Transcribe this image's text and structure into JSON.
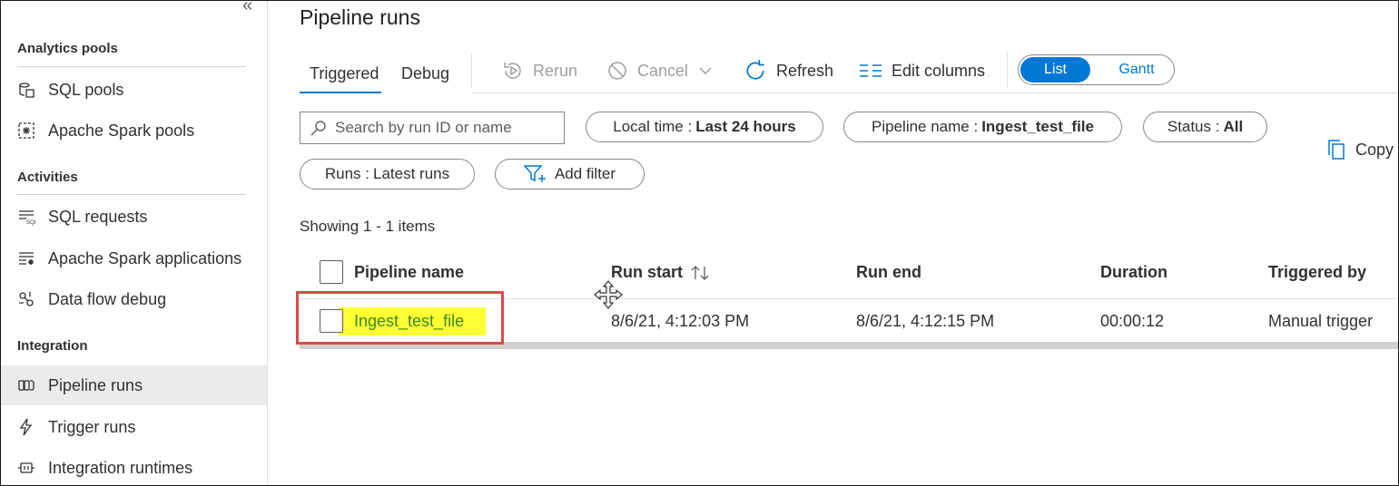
{
  "sidebar": {
    "collapse_glyph": "«",
    "sections": [
      {
        "title": "Analytics pools",
        "items": [
          {
            "label": "SQL pools",
            "icon": "sql-pool-icon"
          },
          {
            "label": "Apache Spark pools",
            "icon": "spark-pool-icon"
          }
        ]
      },
      {
        "title": "Activities",
        "items": [
          {
            "label": "SQL requests",
            "icon": "sql-requests-icon"
          },
          {
            "label": "Apache Spark applications",
            "icon": "spark-applications-icon"
          },
          {
            "label": "Data flow debug",
            "icon": "data-flow-debug-icon"
          }
        ]
      },
      {
        "title": "Integration",
        "items": [
          {
            "label": "Pipeline runs",
            "icon": "pipeline-runs-icon",
            "active": true
          },
          {
            "label": "Trigger runs",
            "icon": "trigger-runs-icon"
          },
          {
            "label": "Integration runtimes",
            "icon": "integration-runtimes-icon"
          }
        ]
      }
    ]
  },
  "main": {
    "title": "Pipeline runs",
    "tabs": [
      {
        "label": "Triggered",
        "selected": true
      },
      {
        "label": "Debug"
      }
    ],
    "toolbar": {
      "rerun": "Rerun",
      "cancel": "Cancel",
      "refresh": "Refresh",
      "edit_columns": "Edit columns",
      "view_toggle": {
        "list": "List",
        "gantt": "Gantt",
        "selected": "List"
      }
    },
    "search_placeholder": "Search by run ID or name",
    "filters": [
      {
        "key": "Local time :",
        "value": "Last 24 hours"
      },
      {
        "key": "Pipeline name :",
        "value": "Ingest_test_file"
      },
      {
        "key": "Status :",
        "value": "All"
      },
      {
        "key": "Runs :",
        "value": "Latest runs"
      }
    ],
    "add_filter": "Add filter",
    "copy": "Copy",
    "showing": "Showing 1 - 1 items",
    "columns": [
      "Pipeline name",
      "Run start",
      "Run end",
      "Duration",
      "Triggered by"
    ],
    "rows": [
      {
        "pipeline_name": "Ingest_test_file",
        "run_start": "8/6/21, 4:12:03 PM",
        "run_end": "8/6/21, 4:12:15 PM",
        "duration": "00:00:12",
        "triggered_by": "Manual trigger"
      }
    ]
  },
  "colors": {
    "accent": "#0078d4",
    "highlight": "#ffff33",
    "annotation_box": "#e04848",
    "link": "#3a8a1e"
  }
}
